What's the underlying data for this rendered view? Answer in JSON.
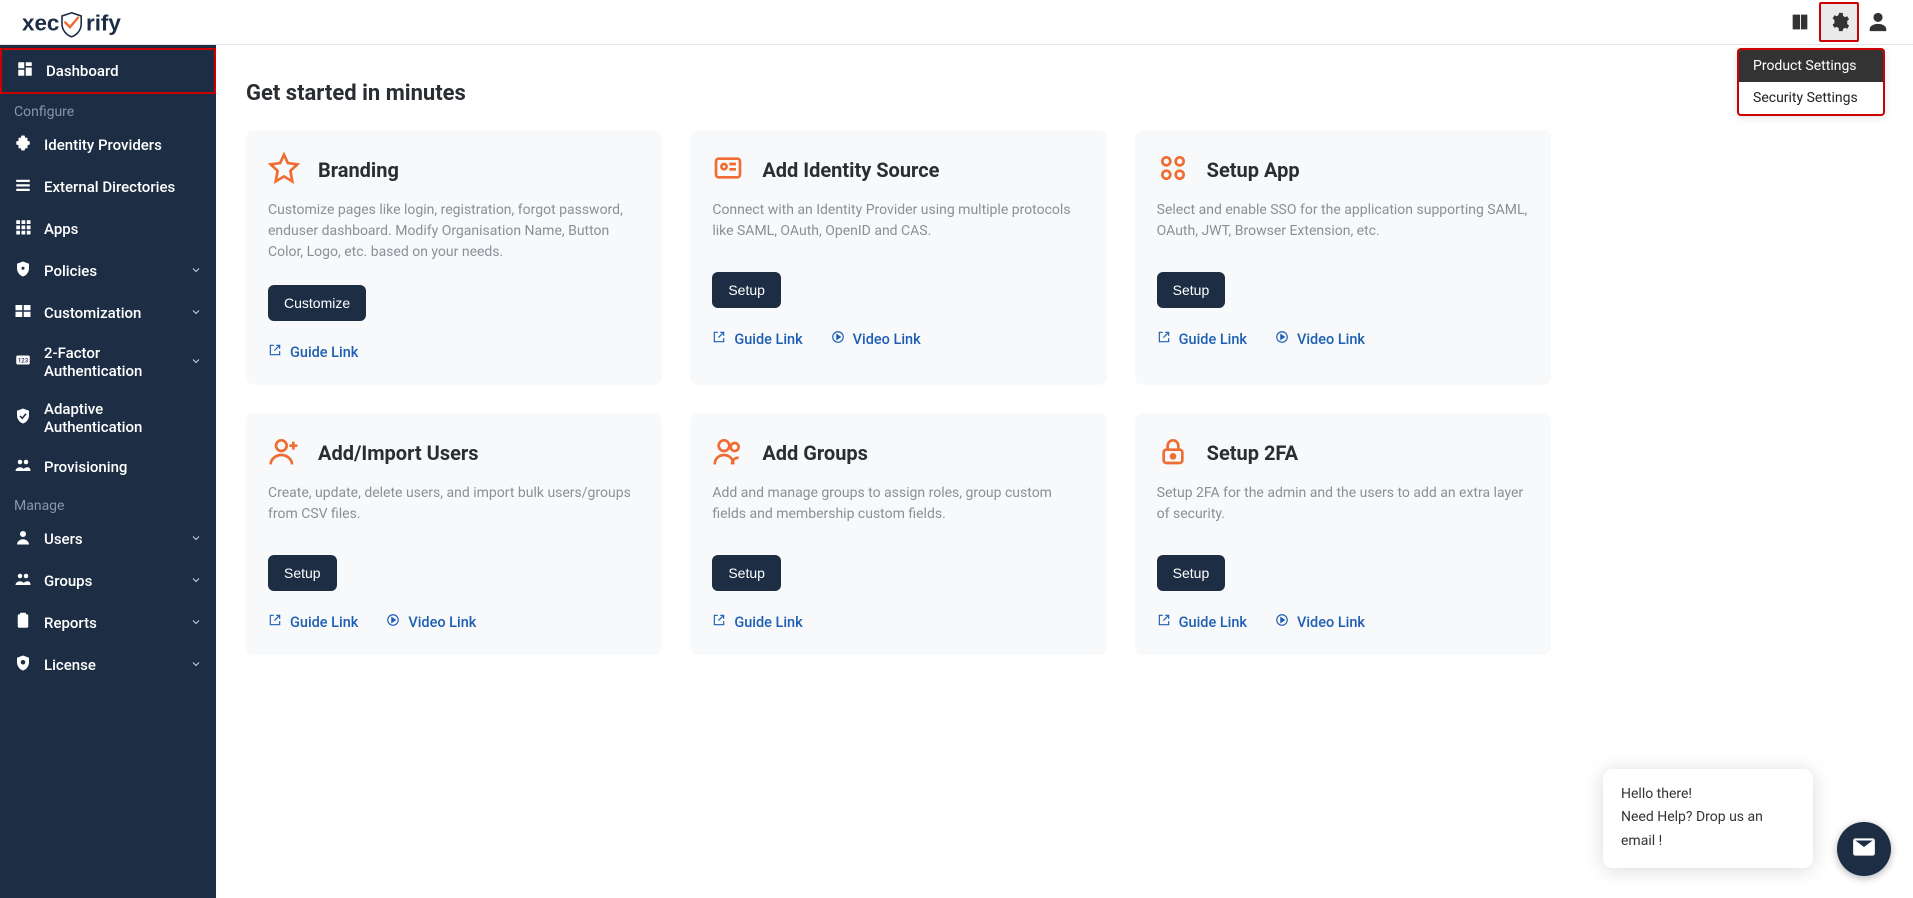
{
  "brand": "xecurify",
  "settings_menu": {
    "items": [
      "Product Settings",
      "Security Settings"
    ],
    "selected_index": 0
  },
  "sidebar": {
    "dashboard_label": "Dashboard",
    "section_configure": "Configure",
    "section_manage": "Manage",
    "configure_items": [
      {
        "label": "Identity Providers",
        "expandable": false
      },
      {
        "label": "External Directories",
        "expandable": false
      },
      {
        "label": "Apps",
        "expandable": false
      },
      {
        "label": "Policies",
        "expandable": true
      },
      {
        "label": "Customization",
        "expandable": true
      },
      {
        "label": "2-Factor Authentication",
        "expandable": true
      },
      {
        "label": "Adaptive Authentication",
        "expandable": false
      },
      {
        "label": "Provisioning",
        "expandable": false
      }
    ],
    "manage_items": [
      {
        "label": "Users",
        "expandable": true
      },
      {
        "label": "Groups",
        "expandable": true
      },
      {
        "label": "Reports",
        "expandable": true
      },
      {
        "label": "License",
        "expandable": true
      }
    ]
  },
  "page": {
    "title": "Get started in minutes"
  },
  "cards": [
    {
      "title": "Branding",
      "desc": "Customize pages like login, registration, forgot password, enduser dashboard. Modify Organisation Name, Button Color, Logo, etc. based on your needs.",
      "button": "Customize",
      "guide_link": "Guide Link",
      "video_link": null
    },
    {
      "title": "Add Identity Source",
      "desc": "Connect with an Identity Provider using multiple protocols like SAML, OAuth, OpenID and CAS.",
      "button": "Setup",
      "guide_link": "Guide Link",
      "video_link": "Video Link"
    },
    {
      "title": "Setup App",
      "desc": "Select and enable SSO for the application supporting SAML, OAuth, JWT, Browser Extension, etc.",
      "button": "Setup",
      "guide_link": "Guide Link",
      "video_link": "Video Link"
    },
    {
      "title": "Add/Import Users",
      "desc": "Create, update, delete users, and import bulk users/groups from CSV files.",
      "button": "Setup",
      "guide_link": "Guide Link",
      "video_link": "Video Link"
    },
    {
      "title": "Add Groups",
      "desc": "Add and manage groups to assign roles, group custom fields and membership custom fields.",
      "button": "Setup",
      "guide_link": "Guide Link",
      "video_link": null
    },
    {
      "title": "Setup 2FA",
      "desc": "Setup 2FA for the admin and the users to add an extra layer of security.",
      "button": "Setup",
      "guide_link": "Guide Link",
      "video_link": "Video Link"
    }
  ],
  "chat": {
    "line1": "Hello there!",
    "line2": "Need Help? Drop us an email !"
  },
  "card_icons": [
    "star",
    "id-card",
    "apps-grid",
    "user-plus",
    "users",
    "lock"
  ]
}
